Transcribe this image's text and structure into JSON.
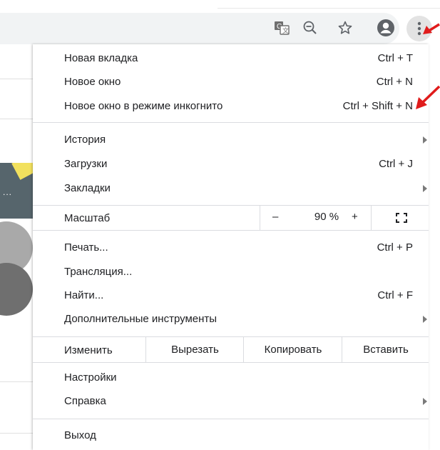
{
  "toolbar": {
    "icons": [
      "translate-icon",
      "zoom-out-icon",
      "bookmark-star-icon",
      "account-icon",
      "menu-kebab-icon"
    ]
  },
  "menu": {
    "group1": [
      {
        "label": "Новая вкладка",
        "shortcut": "Ctrl + T"
      },
      {
        "label": "Новое окно",
        "shortcut": "Ctrl + N"
      },
      {
        "label": "Новое окно в режиме инкогнито",
        "shortcut": "Ctrl + Shift + N"
      }
    ],
    "group2": [
      {
        "label": "История",
        "has_submenu": true
      },
      {
        "label": "Загрузки",
        "shortcut": "Ctrl + J"
      },
      {
        "label": "Закладки",
        "has_submenu": true
      }
    ],
    "zoom": {
      "label": "Масштаб",
      "minus": "–",
      "value": "90 %",
      "plus": "+",
      "fullscreen_icon": "fullscreen-icon"
    },
    "group3": [
      {
        "label": "Печать...",
        "shortcut": "Ctrl + P"
      },
      {
        "label": "Трансляция..."
      },
      {
        "label": "Найти...",
        "shortcut": "Ctrl + F"
      },
      {
        "label": "Дополнительные инструменты",
        "has_submenu": true
      }
    ],
    "edit": {
      "label": "Изменить",
      "cut": "Вырезать",
      "copy": "Копировать",
      "paste": "Вставить"
    },
    "group4": [
      {
        "label": "Настройки"
      },
      {
        "label": "Справка",
        "has_submenu": true
      }
    ],
    "exit": {
      "label": "Выход"
    }
  },
  "colors": {
    "annotation_arrow": "#e01b1b",
    "separator": "#dadce0",
    "omnibox": "#f1f3f4"
  }
}
